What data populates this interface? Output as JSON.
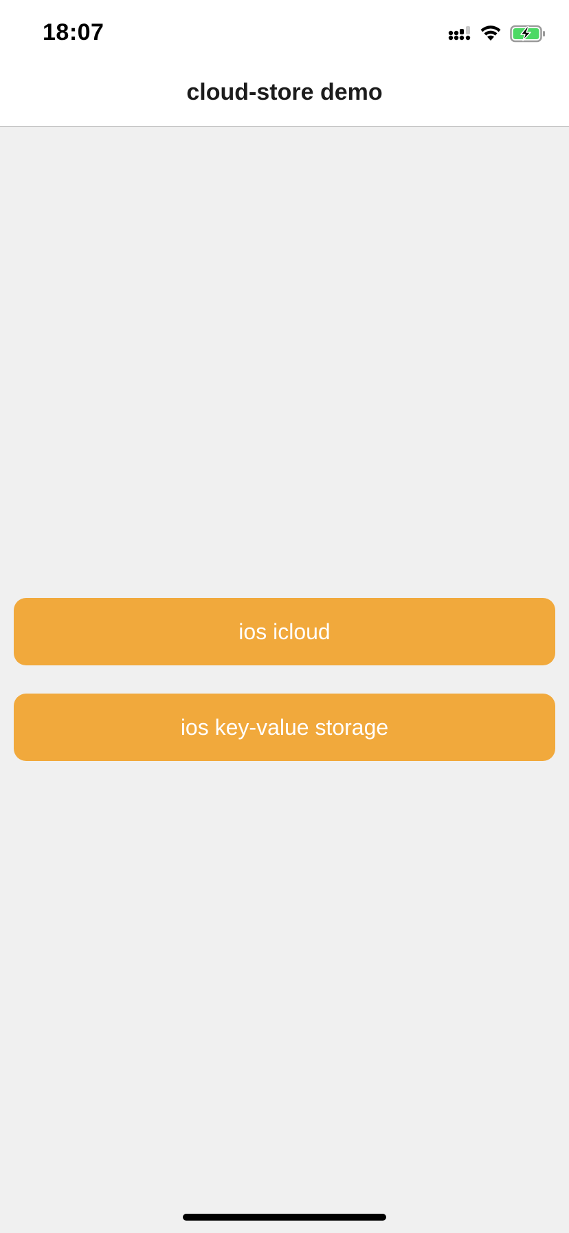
{
  "status_bar": {
    "time": "18:07",
    "signal_icon": "cellular-signal-icon",
    "wifi_icon": "wifi-icon",
    "battery_icon": "battery-charging-icon",
    "battery_color": "#4cd964"
  },
  "nav": {
    "title": "cloud-store demo"
  },
  "buttons": [
    {
      "label": "ios icloud"
    },
    {
      "label": "ios key-value storage"
    }
  ],
  "colors": {
    "accent": "#f1a93c",
    "background": "#f0f0f0",
    "header_background": "#ffffff"
  }
}
